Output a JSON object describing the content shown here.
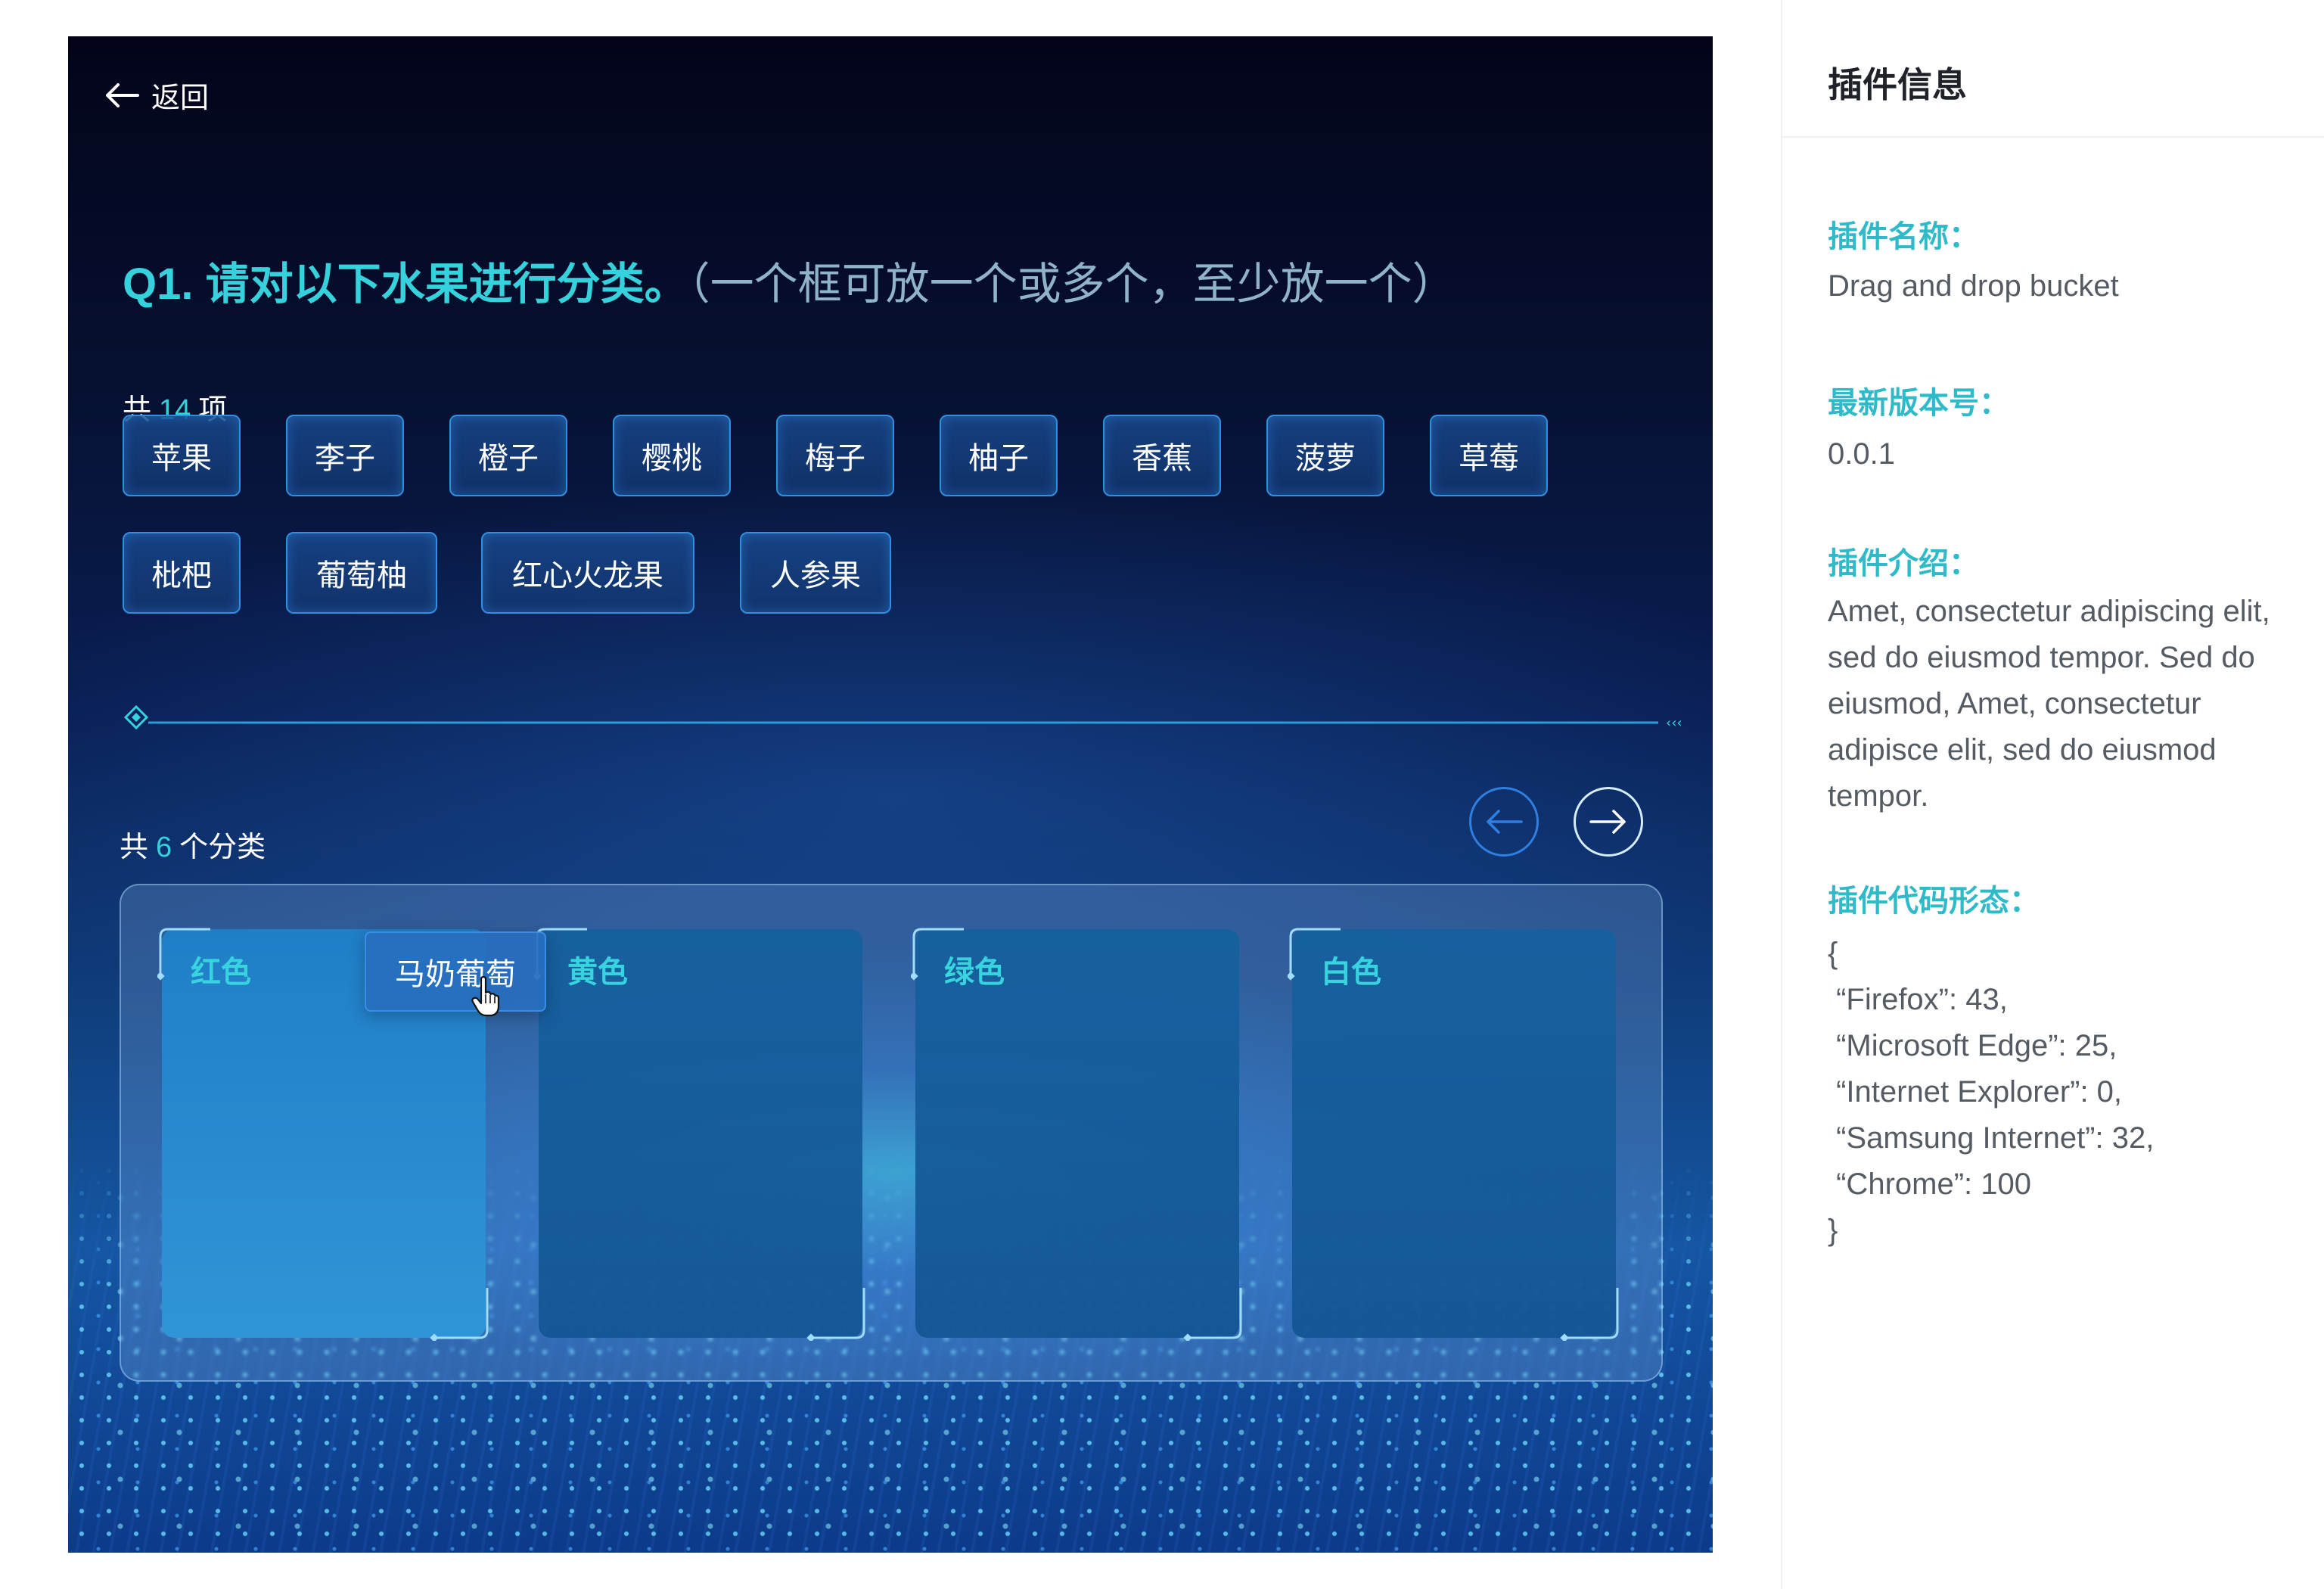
{
  "stage": {
    "back_label": "返回",
    "question": {
      "main": "Q1. 请对以下水果进行分类。",
      "hint": "（一个框可放一个或多个，至少放一个）"
    },
    "items_count": {
      "prefix": "共",
      "value": "14",
      "suffix": "项"
    },
    "items": [
      "苹果",
      "李子",
      "橙子",
      "樱桃",
      "梅子",
      "柚子",
      "香蕉",
      "菠萝",
      "草莓",
      "枇杷",
      "葡萄柚",
      "红心火龙果",
      "人参果"
    ],
    "categories_count": {
      "prefix": "共",
      "value": "6",
      "suffix": "个分类"
    },
    "buckets": [
      "红色",
      "黄色",
      "绿色",
      "白色"
    ],
    "dragging_item": "马奶葡萄",
    "colors": {
      "accent": "#35d1dc",
      "chip_border": "#2f8fe0",
      "bucket_fill": "#16609e",
      "bucket_active": "#2a8ad0"
    },
    "icons": {
      "back": "arrow-left-icon",
      "prev": "arrow-left-circle-icon",
      "next": "arrow-right-circle-icon",
      "cursor": "hand-pointer-icon"
    }
  },
  "info": {
    "title": "插件信息",
    "name_label": "插件名称：",
    "name_value": "Drag and drop bucket",
    "version_label": "最新版本号：",
    "version_value": "0.0.1",
    "intro_label": "插件介绍：",
    "intro_value": "Amet, consectetur adipiscing elit, sed do eiusmod tempor. Sed do eiusmod, Amet, consectetur adipisce elit, sed do eiusmod tempor.",
    "code_label": "插件代码形态：",
    "code_value": "{\n “Firefox”: 43,\n “Microsoft Edge”: 25,\n “Internet Explorer”: 0,\n “Samsung Internet”: 32,\n “Chrome”: 100\n}"
  }
}
